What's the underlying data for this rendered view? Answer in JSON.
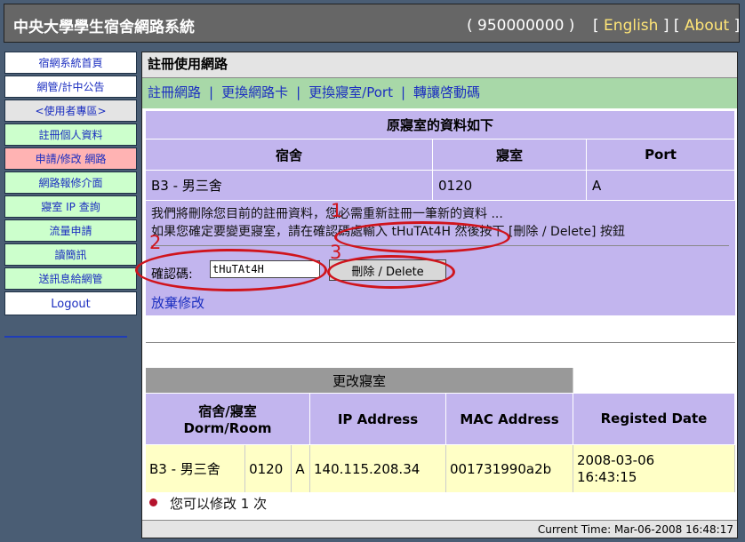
{
  "header": {
    "title": "中央大學學生宿舍網路系統",
    "user_id": "( 950000000 )",
    "lang_link": "English",
    "about_link": "About"
  },
  "sidebar": {
    "items": [
      {
        "label": "宿網系統首頁"
      },
      {
        "label": "網管/計中公告"
      },
      {
        "label": "<使用者專區>"
      },
      {
        "label": "註冊個人資料"
      },
      {
        "label": "申請/修改 網路"
      },
      {
        "label": "網路報修介面"
      },
      {
        "label": "寢室 IP 查詢"
      },
      {
        "label": "流量申請"
      },
      {
        "label": "讀簡訊"
      },
      {
        "label": "送訊息給網管"
      },
      {
        "label": "Logout"
      }
    ]
  },
  "main": {
    "title": "註冊使用網路",
    "subnav": [
      "註冊網路",
      "更換網路卡",
      "更換寢室/Port",
      "轉讓啓動碼"
    ],
    "original": {
      "caption": "原寢室的資料如下",
      "headers": [
        "宿舍",
        "寢室",
        "Port"
      ],
      "row": [
        "B3 - 男三舍",
        "0120",
        "A"
      ]
    },
    "message_line1": "我們將刪除您目前的註冊資料，您必需重新註冊一筆新的資料 ...",
    "message_line2": "如果您確定要變更寢室，請在確認碼處輸入 tHuTAt4H 然後按下 [刪除 / Delete] 按鈕",
    "confirm_label": "確認碼:",
    "confirm_value": "tHuTAt4H",
    "delete_button": "刪除 / Delete",
    "give_up_link": "放棄修改",
    "annotations": [
      "1",
      "2",
      "3"
    ],
    "change": {
      "caption": "更改寢室",
      "headers": [
        "宿舍/寢室\nDorm/Room",
        "IP Address",
        "MAC Address",
        "Registed Date"
      ],
      "row": {
        "dorm": "B3 - 男三舍",
        "room": "0120",
        "port": "A",
        "ip": "140.115.208.34",
        "mac": "001731990a2b",
        "date": "2008-03-06\n16:43:15"
      }
    },
    "status": "您可以修改 1 次",
    "current_time": "Current Time: Mar-06-2008 16:48:17"
  }
}
